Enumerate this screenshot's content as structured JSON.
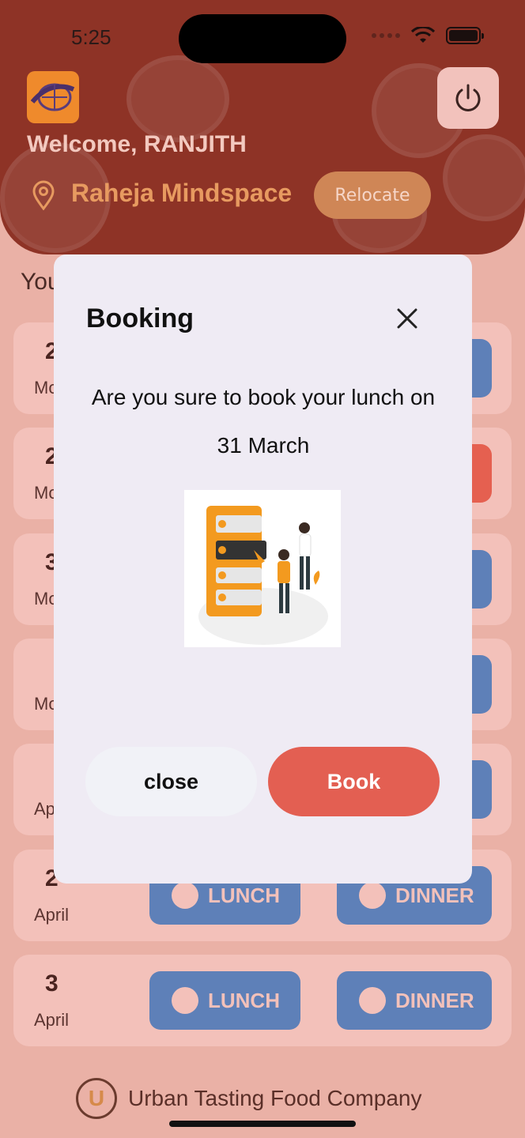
{
  "status_bar": {
    "time": "5:25"
  },
  "header": {
    "welcome": "Welcome, RANJITH",
    "location": "Raheja Mindspace",
    "relocate_label": "Relocate"
  },
  "section_title": "You",
  "days": [
    {
      "num": "2",
      "month": "Mo",
      "lunch": "",
      "dinner": "",
      "dinner_color": "blue"
    },
    {
      "num": "2",
      "month": "Mo",
      "lunch": "",
      "dinner": "",
      "dinner_color": "red"
    },
    {
      "num": "3",
      "month": "Mo",
      "lunch": "",
      "dinner": "",
      "dinner_color": "blue"
    },
    {
      "num": "",
      "month": "Mo",
      "lunch": "",
      "dinner": "",
      "dinner_color": "blue"
    },
    {
      "num": "",
      "month": "Ap",
      "lunch": "",
      "dinner": "",
      "dinner_color": "blue"
    },
    {
      "num": "2",
      "month": "April",
      "lunch": "LUNCH",
      "dinner": "DINNER",
      "dinner_color": "blue"
    },
    {
      "num": "3",
      "month": "April",
      "lunch": "LUNCH",
      "dinner": "DINNER",
      "dinner_color": "blue"
    }
  ],
  "footer": {
    "logo_letter": "U",
    "company": "Urban Tasting Food Company"
  },
  "modal": {
    "title": "Booking",
    "message": "Are you sure to book your lunch on 31 March",
    "close_label": "close",
    "book_label": "Book"
  },
  "icons": {
    "logo": "globe-logo-icon",
    "power": "power-icon",
    "pin": "location-pin-icon",
    "modal_close": "close-icon"
  },
  "colors": {
    "header": "#8e3326",
    "background": "#eab1a6",
    "meal_blue": "#5e80b8",
    "meal_red": "#e56050",
    "book_button": "#e35f52",
    "modal_bg": "#efebf4"
  }
}
